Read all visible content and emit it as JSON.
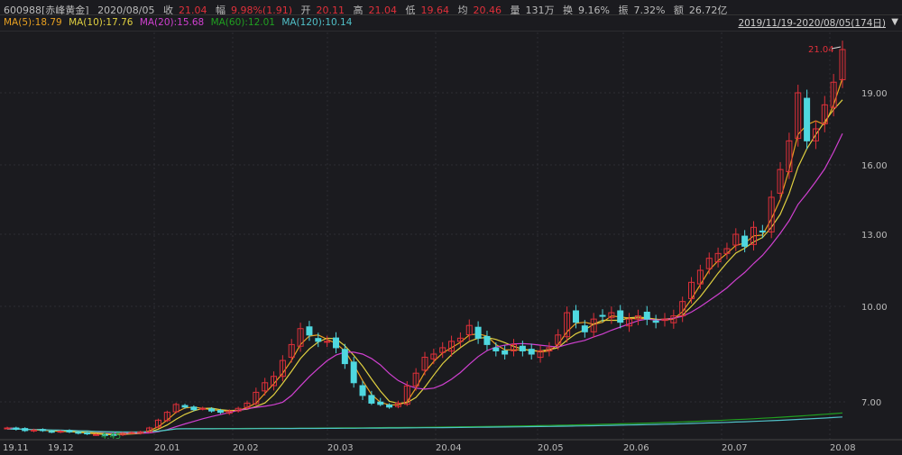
{
  "header": {
    "code": "600988[赤峰黄金]",
    "date": "2020/08/05",
    "close_label": "收",
    "close": "21.04",
    "change_label": "幅",
    "change": "9.98%(1.91)",
    "open_label": "开",
    "open": "20.11",
    "high_label": "高",
    "high": "21.04",
    "low_label": "低",
    "low": "19.64",
    "avg_label": "均",
    "avg": "20.46",
    "vol_label": "量",
    "vol": "131万",
    "turnover_label": "换",
    "turnover": "9.16%",
    "amp_label": "振",
    "amp": "7.32%",
    "amount_label": "额",
    "amount": "26.72亿",
    "range": "2019/11/19-2020/08/05(174日)"
  },
  "ma": [
    {
      "label": "MA(5):18.79",
      "color": "#e8a020"
    },
    {
      "label": "MA(10):17.76",
      "color": "#e0d040"
    },
    {
      "label": "MA(20):15.68",
      "color": "#d040d0"
    },
    {
      "label": "MA(60):12.01",
      "color": "#20a020"
    },
    {
      "label": "MA(120):10.14",
      "color": "#50c0c8"
    }
  ],
  "chart_data": {
    "type": "candlestick",
    "title": "600988 赤峰黄金 日K",
    "x_ticks": [
      "19.11",
      "19.12",
      "20.01",
      "20.02",
      "20.03",
      "20.04",
      "20.05",
      "20.06",
      "20.07",
      "20.08"
    ],
    "y_ticks": [
      "7.00",
      "10.00",
      "13.00",
      "16.00",
      "19.00"
    ],
    "y_tick_values": [
      7,
      10,
      13,
      16,
      19
    ],
    "max_label": "21.04",
    "min_label": "4.45",
    "closes": [
      5.0,
      4.9,
      4.8,
      4.85,
      4.8,
      4.7,
      4.75,
      4.7,
      4.6,
      4.55,
      4.5,
      4.45,
      4.5,
      4.6,
      4.65,
      4.7,
      5.0,
      5.6,
      6.2,
      6.8,
      6.6,
      6.4,
      6.5,
      6.3,
      6.2,
      6.3,
      6.5,
      6.9,
      7.3,
      7.6,
      7.8,
      8.3,
      8.8,
      9.3,
      9.1,
      8.9,
      8.9,
      8.7,
      8.2,
      7.6,
      7.2,
      6.9,
      6.8,
      6.6,
      6.9,
      7.5,
      7.9,
      8.4,
      8.5,
      8.7,
      8.9,
      9.0,
      9.4,
      9.0,
      8.8,
      8.6,
      8.5,
      8.8,
      8.6,
      8.5,
      8.6,
      8.7,
      9.1,
      9.8,
      9.5,
      9.2,
      9.6,
      9.7,
      9.8,
      9.5,
      9.6,
      9.7,
      9.6,
      9.5,
      9.6,
      9.7,
      10.2,
      11.0,
      11.5,
      12.0,
      12.2,
      12.4,
      13.0,
      12.5,
      13.3,
      13.1,
      14.6,
      15.8,
      17.0,
      19.0,
      17.0,
      17.5,
      18.5,
      19.5,
      21.04
    ],
    "ma_windows": [
      5,
      10,
      20,
      60,
      120
    ]
  }
}
